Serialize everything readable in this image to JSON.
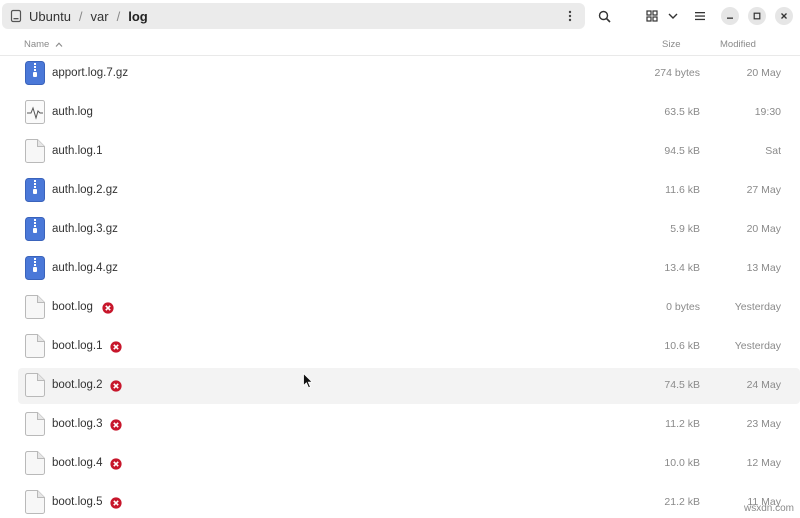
{
  "pathbar": {
    "crumbs": [
      "Ubuntu",
      "var",
      "log"
    ],
    "separator": "/"
  },
  "columns": {
    "name": "Name",
    "size": "Size",
    "modified": "Modified"
  },
  "files": [
    {
      "name": "apport.log.7.gz",
      "size": "274 bytes",
      "modified": "20 May",
      "type": "archive",
      "no_permission": false
    },
    {
      "name": "auth.log",
      "size": "63.5 kB",
      "modified": "19:30",
      "type": "log",
      "no_permission": false
    },
    {
      "name": "auth.log.1",
      "size": "94.5 kB",
      "modified": "Sat",
      "type": "text",
      "no_permission": false
    },
    {
      "name": "auth.log.2.gz",
      "size": "11.6 kB",
      "modified": "27 May",
      "type": "archive",
      "no_permission": false
    },
    {
      "name": "auth.log.3.gz",
      "size": "5.9 kB",
      "modified": "20 May",
      "type": "archive",
      "no_permission": false
    },
    {
      "name": "auth.log.4.gz",
      "size": "13.4 kB",
      "modified": "13 May",
      "type": "archive",
      "no_permission": false
    },
    {
      "name": "boot.log",
      "size": "0 bytes",
      "modified": "Yesterday",
      "type": "text",
      "no_permission": true
    },
    {
      "name": "boot.log.1",
      "size": "10.6 kB",
      "modified": "Yesterday",
      "type": "text",
      "no_permission": true
    },
    {
      "name": "boot.log.2",
      "size": "74.5 kB",
      "modified": "24 May",
      "type": "text",
      "no_permission": true
    },
    {
      "name": "boot.log.3",
      "size": "11.2 kB",
      "modified": "23 May",
      "type": "text",
      "no_permission": true
    },
    {
      "name": "boot.log.4",
      "size": "10.0 kB",
      "modified": "12 May",
      "type": "text",
      "no_permission": true
    },
    {
      "name": "boot.log.5",
      "size": "21.2 kB",
      "modified": "11 May",
      "type": "text",
      "no_permission": true
    }
  ],
  "icons": {
    "drive": "drive-icon",
    "path_menu": "vertical-dots-icon",
    "search": "search-icon",
    "view": "grid-view-icon",
    "view_options": "chevron-down-icon",
    "menu": "hamburger-icon",
    "minimize": "minimize-icon",
    "maximize": "maximize-icon",
    "close": "close-icon",
    "sort": "sort-ascending-icon",
    "no_permission": "no-permission-icon"
  },
  "colors": {
    "archive_icon": "#4a78d8",
    "no_permission_badge": "#c7162b",
    "row_hover": "#f3f3f3"
  },
  "watermark": "wsxdn.com"
}
